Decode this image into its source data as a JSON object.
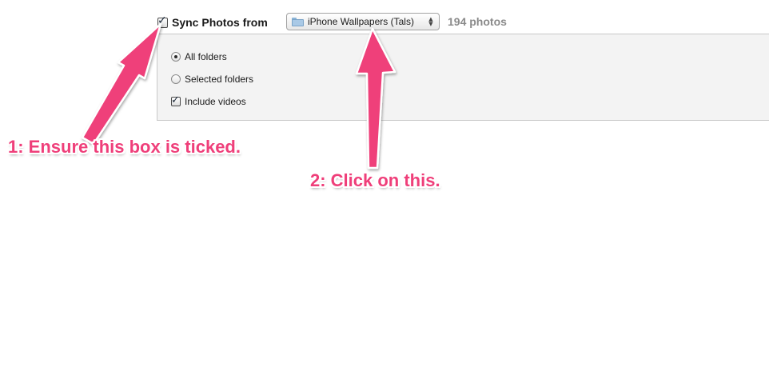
{
  "sync": {
    "label": "Sync Photos from",
    "checked": true,
    "source_label": "iPhone Wallpapers (Tals)",
    "source_icon": "folder-icon",
    "count_label": "194 photos"
  },
  "options": {
    "all_folders_label": "All folders",
    "all_folders_selected": true,
    "selected_folders_label": "Selected folders",
    "selected_folders_selected": false,
    "include_videos_label": "Include videos",
    "include_videos_checked": true
  },
  "annotations": {
    "step1": "1: Ensure this box is ticked.",
    "step2": "2: Click on this.",
    "color": "#ef3f7a"
  },
  "colors": {
    "panel_background": "#f3f3f3",
    "count_text": "#8a8a8a"
  }
}
